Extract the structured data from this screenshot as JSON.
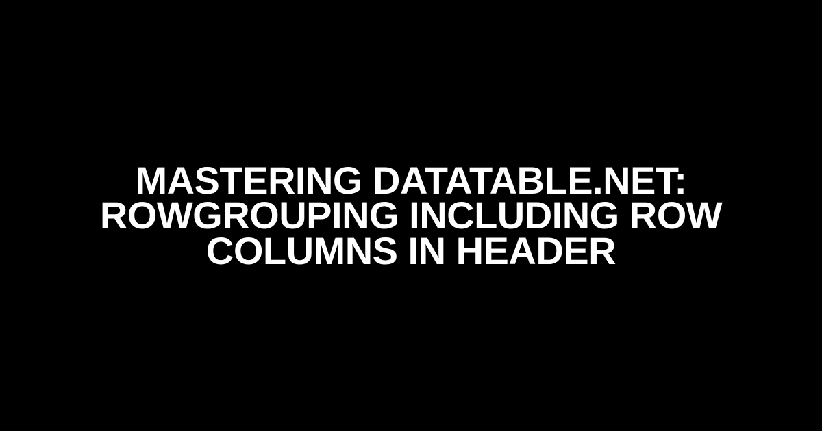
{
  "title": "Mastering DataTable.net: RowGrouping including Row Columns in Header"
}
